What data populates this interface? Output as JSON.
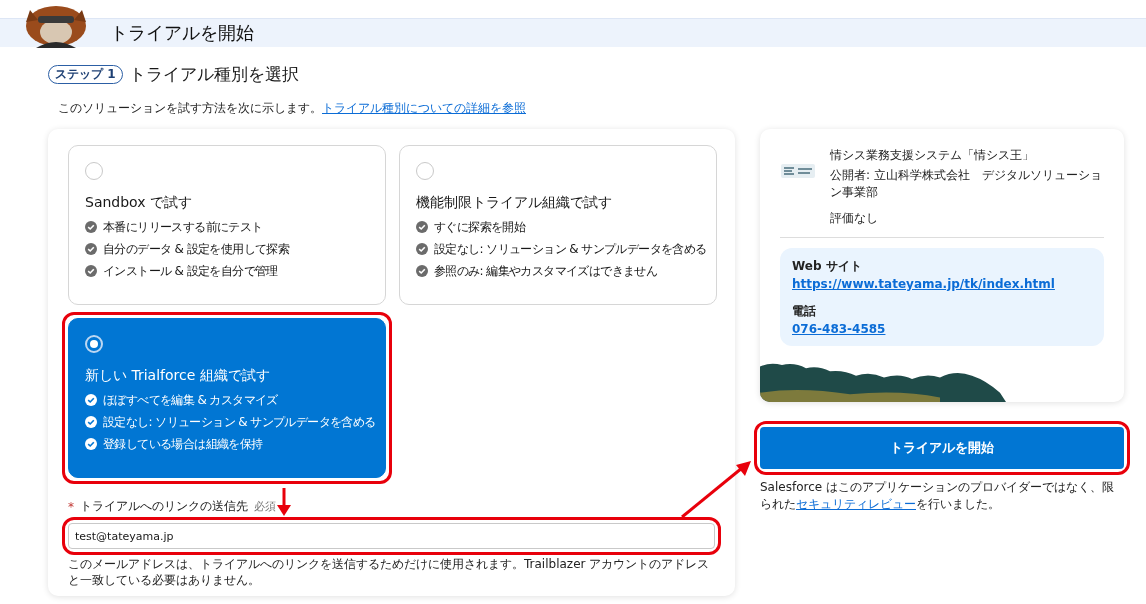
{
  "header": {
    "title": "トライアルを開始"
  },
  "step": {
    "badge": "ステップ 1",
    "title": "トライアル種別を選択"
  },
  "intro": {
    "text": "このソリューションを試す方法を次に示します。",
    "link": "トライアル種別についての詳細を参照"
  },
  "options": [
    {
      "title": "Sandbox で試す",
      "features": [
        "本番にリリースする前にテスト",
        "自分のデータ & 設定を使用して探索",
        "インストール & 設定を自分で管理"
      ],
      "selected": false,
      "highlighted": false
    },
    {
      "title": "機能制限トライアル組織で試す",
      "features": [
        "すぐに探索を開始",
        "設定なし: ソリューション & サンプルデータを含める",
        "参照のみ: 編集やカスタマイズはできません"
      ],
      "selected": false,
      "highlighted": false
    },
    {
      "title": "新しい Trialforce 組織で試す",
      "features": [
        "ほぼすべてを編集 & カスタマイズ",
        "設定なし: ソリューション & サンプルデータを含める",
        "登録している場合は組織を保持"
      ],
      "selected": true,
      "highlighted": true
    }
  ],
  "email": {
    "required_mark": "*",
    "label": "トライアルへのリンクの送信先",
    "required": "必須",
    "value": "test@tateyama.jp",
    "help": "このメールアドレスは、トライアルへのリンクを送信するためだけに使用されます。Trailblazer アカウントのアドレスと一致している必要はありません。",
    "highlighted": true
  },
  "listing": {
    "name": "情シス業務支援システム「情シス王」",
    "publisher": "公開者: 立山科学株式会社　デジタルソリューション事業部",
    "rating": "評価なし",
    "website_label": "Web サイト",
    "website": "https://www.tateyama.jp/tk/index.html",
    "phone_label": "電話",
    "phone": "076-483-4585"
  },
  "start_button": {
    "label": "トライアルを開始",
    "highlighted": true
  },
  "disclaimer": {
    "text": "Salesforce はこのアプリケーションのプロバイダーではなく、限られた",
    "link": "セキュリティレビュー",
    "suffix": "を行いました。"
  }
}
